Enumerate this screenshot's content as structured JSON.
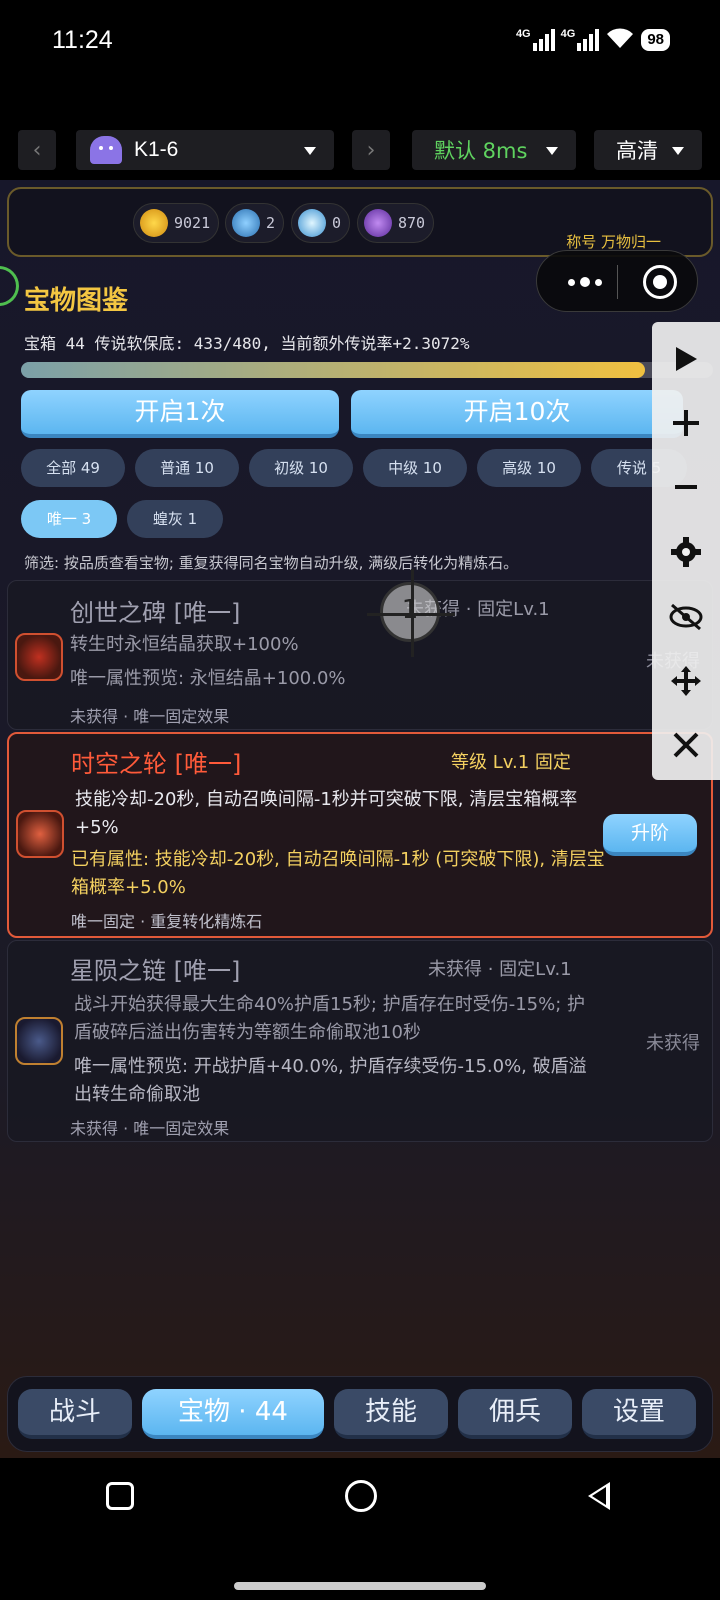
{
  "status_bar": {
    "time": "11:24",
    "net1": "4G",
    "net2": "4G",
    "battery": "98"
  },
  "toolbar": {
    "device": "K1-6",
    "latency": "默认 8ms",
    "quality": "高清",
    "icons": [
      "chevron-left-icon",
      "android-icon",
      "chevron-right-icon",
      "caret-down-icon"
    ]
  },
  "resources": [
    {
      "value": "9021",
      "icon": "gold-coin-icon",
      "color": "#f2b01e"
    },
    {
      "value": "2",
      "icon": "blue-gem-icon",
      "color": "#4da6e8"
    },
    {
      "value": "0",
      "icon": "diamond-icon",
      "color": "#7fd0ff"
    },
    {
      "value": "870",
      "icon": "purple-crystal-icon",
      "color": "#9b5fd6"
    }
  ],
  "title_label": "称号 万物归一",
  "panel": {
    "title": "宝物图鉴",
    "stats": "宝箱 44  传说软保底: 433/480, 当前额外传说率+2.3072%",
    "progress": 0.902,
    "open_one": "开启1次",
    "open_ten": "开启10次",
    "filters": [
      {
        "label": "全部 49",
        "active": false
      },
      {
        "label": "普通 10",
        "active": false
      },
      {
        "label": "初级 10",
        "active": false
      },
      {
        "label": "中级 10",
        "active": false
      },
      {
        "label": "高级 10",
        "active": false
      },
      {
        "label": "传说 5",
        "active": false
      },
      {
        "label": "唯一 3",
        "active": true
      },
      {
        "label": "蝗灰 1",
        "active": false
      }
    ],
    "filter_note": "筛选: 按品质查看宝物; 重复获得同名宝物自动升级, 满级后转化为精炼石。"
  },
  "crosshair_number": "1",
  "items": [
    {
      "name": "创世之碑 [唯一]",
      "meta": "未获得  ·  固定Lv.1",
      "desc1": "转生时永恒结晶获取+100%",
      "desc2": "唯一属性预览: 永恒结晶+100.0%",
      "foot": "未获得  ·  唯一固定效果",
      "state": "未获得"
    },
    {
      "name": "时空之轮 [唯一]",
      "meta": "等级 Lv.1 固定",
      "desc1": "技能冷却-20秒, 自动召唤间隔-1秒并可突破下限, 清层宝箱概率+5%",
      "desc2": "已有属性: 技能冷却-20秒, 自动召唤间隔-1秒 (可突破下限), 清层宝箱概率+5.0%",
      "foot": "唯一固定  ·  重复转化精炼石",
      "action": "升阶"
    },
    {
      "name": "星陨之链 [唯一]",
      "meta": "未获得  ·  固定Lv.1",
      "desc1": "战斗开始获得最大生命40%护盾15秒; 护盾存在时受伤-15%; 护盾破碎后溢出伤害转为等额生命偷取池10秒",
      "desc2": "唯一属性预览: 开战护盾+40.0%, 护盾存续受伤-15.0%, 破盾溢出转生命偷取池",
      "foot": "未获得  ·  唯一固定效果",
      "state": "未获得"
    }
  ],
  "float_tools": [
    "play-icon",
    "zoom-in-icon",
    "zoom-out-icon",
    "settings-gear-icon",
    "hide-eye-icon",
    "move-icon",
    "close-icon"
  ],
  "bottom_nav": [
    {
      "label": "战斗",
      "active": false
    },
    {
      "label": "宝物 · 44",
      "active": true
    },
    {
      "label": "技能",
      "active": false
    },
    {
      "label": "佣兵",
      "active": false
    },
    {
      "label": "设置",
      "active": false
    }
  ]
}
